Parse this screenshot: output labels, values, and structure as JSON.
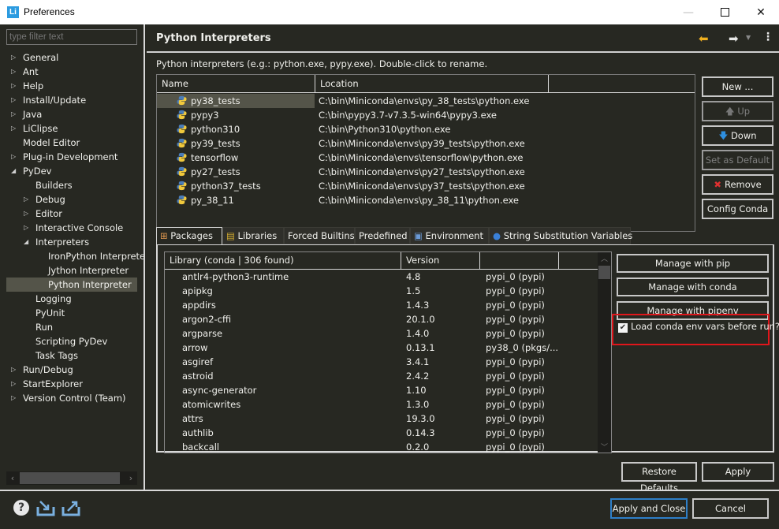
{
  "window": {
    "title": "Preferences",
    "app_icon": "Li",
    "controls": {
      "minimize": "—",
      "close": "✕"
    }
  },
  "sidebar": {
    "filter_placeholder": "type filter text",
    "items": [
      {
        "label": "General",
        "level": 0,
        "twisty": "collapsed"
      },
      {
        "label": "Ant",
        "level": 0,
        "twisty": "collapsed"
      },
      {
        "label": "Help",
        "level": 0,
        "twisty": "collapsed"
      },
      {
        "label": "Install/Update",
        "level": 0,
        "twisty": "collapsed"
      },
      {
        "label": "Java",
        "level": 0,
        "twisty": "collapsed"
      },
      {
        "label": "LiClipse",
        "level": 0,
        "twisty": "collapsed"
      },
      {
        "label": "Model Editor",
        "level": 0,
        "twisty": "none"
      },
      {
        "label": "Plug-in Development",
        "level": 0,
        "twisty": "collapsed"
      },
      {
        "label": "PyDev",
        "level": 0,
        "twisty": "expanded"
      },
      {
        "label": "Builders",
        "level": 1,
        "twisty": "none"
      },
      {
        "label": "Debug",
        "level": 1,
        "twisty": "collapsed"
      },
      {
        "label": "Editor",
        "level": 1,
        "twisty": "collapsed"
      },
      {
        "label": "Interactive Console",
        "level": 1,
        "twisty": "collapsed"
      },
      {
        "label": "Interpreters",
        "level": 1,
        "twisty": "expanded"
      },
      {
        "label": "IronPython Interprete",
        "level": 2,
        "twisty": "none"
      },
      {
        "label": "Jython Interpreter",
        "level": 2,
        "twisty": "none"
      },
      {
        "label": "Python Interpreter",
        "level": 2,
        "twisty": "none",
        "selected": true
      },
      {
        "label": "Logging",
        "level": 1,
        "twisty": "none"
      },
      {
        "label": "PyUnit",
        "level": 1,
        "twisty": "none"
      },
      {
        "label": "Run",
        "level": 1,
        "twisty": "none"
      },
      {
        "label": "Scripting PyDev",
        "level": 1,
        "twisty": "none"
      },
      {
        "label": "Task Tags",
        "level": 1,
        "twisty": "none"
      },
      {
        "label": "Run/Debug",
        "level": 0,
        "twisty": "collapsed"
      },
      {
        "label": "StartExplorer",
        "level": 0,
        "twisty": "collapsed"
      },
      {
        "label": "Version Control (Team)",
        "level": 0,
        "twisty": "collapsed"
      }
    ]
  },
  "header": {
    "title": "Python Interpreters",
    "icons": [
      "back-arrow-icon",
      "forward-arrow-icon",
      "dropdown-icon",
      "menu-icon"
    ]
  },
  "interpreters": {
    "description": "Python interpreters (e.g.: python.exe, pypy.exe).   Double-click to rename.",
    "columns": [
      "Name",
      "Location",
      ""
    ],
    "rows": [
      {
        "name": "py38_tests",
        "location": "C:\\bin\\Miniconda\\envs\\py_38_tests\\python.exe",
        "selected": true
      },
      {
        "name": "pypy3",
        "location": "C:\\bin\\pypy3.7-v7.3.5-win64\\pypy3.exe"
      },
      {
        "name": "python310",
        "location": "C:\\bin\\Python310\\python.exe"
      },
      {
        "name": "py39_tests",
        "location": "C:\\bin\\Miniconda\\envs\\py39_tests\\python.exe"
      },
      {
        "name": "tensorflow",
        "location": "C:\\bin\\Miniconda\\envs\\tensorflow\\python.exe"
      },
      {
        "name": "py27_tests",
        "location": "C:\\bin\\Miniconda\\envs\\py27_tests\\python.exe"
      },
      {
        "name": "python37_tests",
        "location": "C:\\bin\\Miniconda\\envs\\py37_tests\\python.exe"
      },
      {
        "name": "py_38_11",
        "location": "C:\\bin\\Miniconda\\envs\\py_38_11\\python.exe"
      }
    ],
    "buttons": {
      "new": {
        "label": "New ...",
        "enabled": true
      },
      "up": {
        "label": "Up",
        "enabled": false
      },
      "down": {
        "label": "Down",
        "enabled": true
      },
      "set_default": {
        "label": "Set as Default",
        "enabled": false
      },
      "remove": {
        "label": "Remove",
        "enabled": true
      },
      "config_conda": {
        "label": "Config Conda",
        "enabled": true
      }
    }
  },
  "tabs": [
    {
      "label": "Packages",
      "icon": "package-icon",
      "active": true
    },
    {
      "label": "Libraries",
      "icon": "libraries-icon"
    },
    {
      "label": "Forced Builtins"
    },
    {
      "label": "Predefined"
    },
    {
      "label": "Environment",
      "icon": "environment-icon"
    },
    {
      "label": "String Substitution Variables",
      "icon": "variable-icon"
    }
  ],
  "packages": {
    "columns": [
      "Library (conda | 306 found)",
      "Version",
      ""
    ],
    "rows": [
      {
        "name": "antlr4-python3-runtime",
        "version": "4.8",
        "source": "pypi_0 (pypi)"
      },
      {
        "name": "apipkg",
        "version": "1.5",
        "source": "pypi_0 (pypi)"
      },
      {
        "name": "appdirs",
        "version": "1.4.3",
        "source": "pypi_0 (pypi)"
      },
      {
        "name": "argon2-cffi",
        "version": "20.1.0",
        "source": "pypi_0 (pypi)"
      },
      {
        "name": "argparse",
        "version": "1.4.0",
        "source": "pypi_0 (pypi)"
      },
      {
        "name": "arrow",
        "version": "0.13.1",
        "source": "py38_0 (pkgs/..."
      },
      {
        "name": "asgiref",
        "version": "3.4.1",
        "source": "pypi_0 (pypi)"
      },
      {
        "name": "astroid",
        "version": "2.4.2",
        "source": "pypi_0 (pypi)"
      },
      {
        "name": "async-generator",
        "version": "1.10",
        "source": "pypi_0 (pypi)"
      },
      {
        "name": "atomicwrites",
        "version": "1.3.0",
        "source": "pypi_0 (pypi)"
      },
      {
        "name": "attrs",
        "version": "19.3.0",
        "source": "pypi_0 (pypi)"
      },
      {
        "name": "authlib",
        "version": "0.14.3",
        "source": "pypi_0 (pypi)"
      },
      {
        "name": "backcall",
        "version": "0.2.0",
        "source": "pypi_0 (pypi)"
      }
    ],
    "manage_pip": "Manage with pip",
    "manage_conda": "Manage with conda",
    "manage_pipenv": "Manage with pipenv",
    "load_conda_env": {
      "label": "Load conda env vars before run?",
      "checked": true
    }
  },
  "page_buttons": {
    "restore_defaults": "Restore Defaults",
    "apply": "Apply"
  },
  "footer": {
    "apply_and_close": "Apply and Close",
    "cancel": "Cancel",
    "help": "?"
  },
  "colors": {
    "background": "#272822",
    "selection": "#545449",
    "highlight_box": "#e0161b",
    "primary_button_border": "#2e7fc8"
  }
}
